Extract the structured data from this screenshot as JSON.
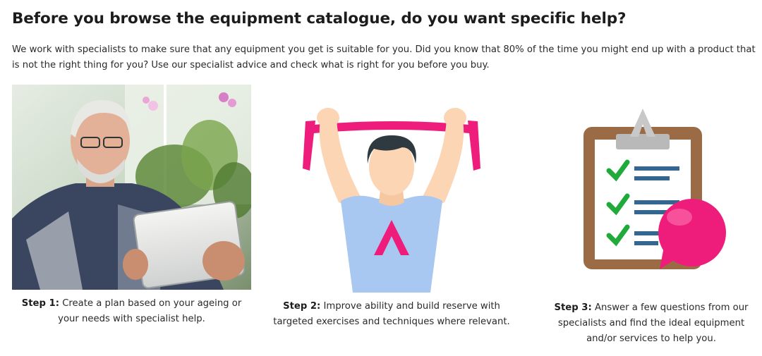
{
  "heading": "Before you browse the equipment catalogue, do you want specific help?",
  "intro": "We work with specialists to make sure that any equipment you get is suitable for you. Did you know that 80% of the time you might end up with a product that is not the right thing for you? Use our specialist advice and check what is right for you before you buy.",
  "steps": [
    {
      "label": "Step 1:",
      "text": "Create a plan based on your ageing or your needs with specialist help.",
      "icon": "elderly-man-tablet-photo"
    },
    {
      "label": "Step 2:",
      "text": "Improve ability and build reserve with targeted exercises and techniques where relevant.",
      "icon": "exercise-person-icon"
    },
    {
      "label": "Step 3:",
      "text": "Answer a few questions from our specialists and find the ideal equipment and/or services to help you.",
      "icon": "clipboard-checklist-icon"
    }
  ],
  "colors": {
    "accent_pink": "#ee1d7b",
    "shirt_blue": "#a8c8f2",
    "skin": "#fbd5b4",
    "clipboard_brown": "#9b6b45",
    "check_green": "#1faa3a",
    "line_blue": "#35668f"
  }
}
